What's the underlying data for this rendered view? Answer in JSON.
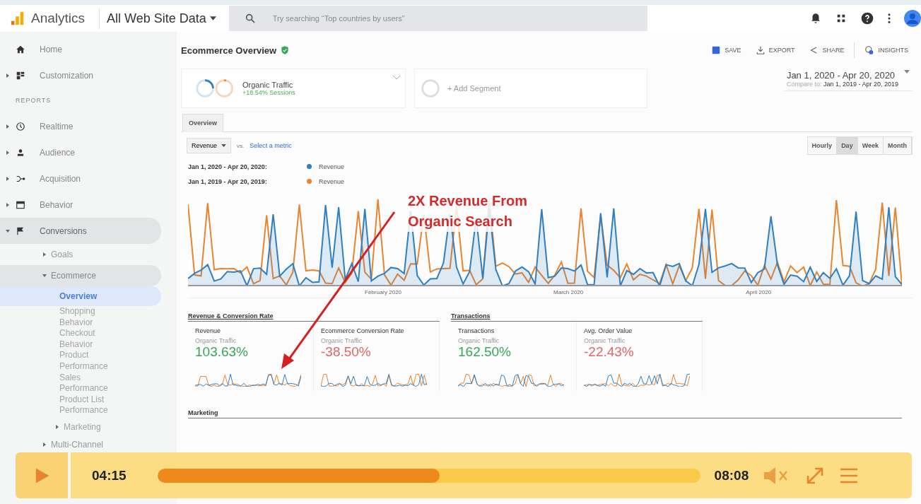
{
  "header": {
    "product": "Analytics",
    "property": "All Web Site Data",
    "search": {
      "placeholder": "Try searching “Top countries by users”"
    }
  },
  "sidebar": {
    "items": [
      {
        "kind": "nav",
        "label": "Home",
        "selected": false
      },
      {
        "kind": "nav",
        "label": "Customization",
        "expanded": false,
        "selected": false
      },
      {
        "kind": "section",
        "label": "REPORTS"
      },
      {
        "kind": "nav",
        "label": "Realtime",
        "expanded": false,
        "selected": false
      },
      {
        "kind": "nav",
        "label": "Audience",
        "expanded": false,
        "selected": false
      },
      {
        "kind": "nav",
        "label": "Acquisition",
        "expanded": false,
        "selected": false
      },
      {
        "kind": "nav",
        "label": "Behavior",
        "expanded": false,
        "selected": false
      },
      {
        "kind": "nav",
        "label": "Conversions",
        "expanded": true,
        "selected": true,
        "children": [
          {
            "label": "Goals",
            "expanded": false,
            "selected": false
          },
          {
            "label": "Ecommerce",
            "expanded": true,
            "selected": true,
            "children": [
              {
                "label": "Overview",
                "selected": true
              },
              {
                "label": "Shopping Behavior",
                "selected": false
              },
              {
                "label": "Checkout Behavior",
                "selected": false
              },
              {
                "label": "Product Performance",
                "selected": false
              },
              {
                "label": "Sales Performance",
                "selected": false
              },
              {
                "label": "Product List Performance",
                "selected": false
              },
              {
                "label": "Marketing",
                "expanded": false,
                "selected": false
              }
            ]
          },
          {
            "label": "Multi-Channel",
            "expanded": false,
            "selected": false
          }
        ]
      }
    ]
  },
  "page": {
    "title": "Ecommerce Overview",
    "actions": [
      "SAVE",
      "EXPORT",
      "SHARE",
      "INSIGHTS"
    ],
    "segment": {
      "name": "Organic Traffic",
      "detail": "+18.54% Sessions"
    },
    "add_segment": "+ Add Segment",
    "date_range": {
      "range": "Jan 1, 2020 - Apr 20, 2020",
      "compare_label": "Compare to:",
      "compare": "Jan 1, 2019 - Apr 20, 2019"
    },
    "tabs": [
      {
        "label": "Overview",
        "selected": true
      }
    ],
    "metric": "Revenue",
    "vs": "vs.",
    "select_metric": "Select a metric",
    "granularity": [
      {
        "label": "Hourly",
        "selected": false
      },
      {
        "label": "Day",
        "selected": true
      },
      {
        "label": "Week",
        "selected": false
      },
      {
        "label": "Month",
        "selected": false
      }
    ],
    "legend": [
      {
        "range": "Jan 1, 2020 - Apr 20, 2020:",
        "label": "Revenue",
        "color": "#2f7fc1"
      },
      {
        "range": "Jan 1, 2019 - Apr 20, 2019:",
        "label": "Revenue",
        "color": "#e8832e"
      }
    ],
    "chart_months": [
      "February 2020",
      "March 2020",
      "April 2020"
    ],
    "annotation": [
      "2X Revenue From",
      "Organic Search"
    ],
    "groups": [
      {
        "title": "Revenue & Conversion Rate",
        "cards": [
          {
            "label": "Revenue",
            "segment": "Organic Traffic",
            "value": "103.63%",
            "positive": true
          },
          {
            "label": "Ecommerce Conversion Rate",
            "segment": "Organic Traffic",
            "value": "-38.50%",
            "positive": false
          }
        ]
      },
      {
        "title": "Transactions",
        "cards": [
          {
            "label": "Transactions",
            "segment": "Organic Traffic",
            "value": "162.50%",
            "positive": true
          },
          {
            "label": "Avg. Order Value",
            "segment": "Organic Traffic",
            "value": "-22.43%",
            "positive": false
          }
        ]
      }
    ],
    "marketing": {
      "title": "Marketing"
    }
  },
  "player": {
    "current": "04:15",
    "total": "08:08",
    "level": 0.52,
    "muted": true
  }
}
